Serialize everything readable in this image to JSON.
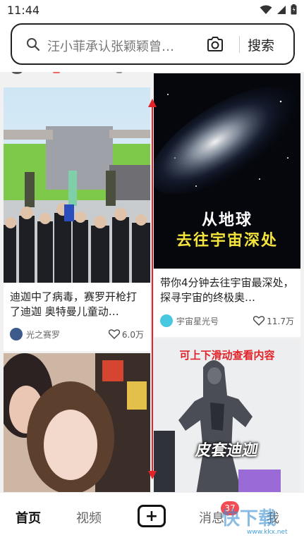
{
  "status_bar": {
    "time": "11:44"
  },
  "search": {
    "query": "汪小菲承认张颖颖曾…",
    "button_label": "搜索"
  },
  "feed": {
    "cards": [
      {
        "title": "迪迦中了病毒，赛罗开枪打了迪迦 奥特曼儿童动…",
        "author": "光之赛罗",
        "likes": "6.0万"
      },
      {
        "title": "带你4分钟去往宇宙最深处，探寻宇宙的终极奥…",
        "author": "宇宙星光号",
        "likes": "11.7万",
        "overlay_line1": "从地球",
        "overlay_line2": "去往宇宙深处"
      },
      {
        "title": ""
      },
      {
        "title": "",
        "overlay_top": "可上下滑动查看内容",
        "overlay_bottom": "皮套迪迦"
      }
    ]
  },
  "tabs": {
    "home": "首页",
    "video": "视频",
    "add": "+",
    "messages": "消息",
    "messages_badge": "37",
    "me": "我"
  },
  "watermark": {
    "text": "快下载",
    "site": "www.kkx.net"
  },
  "colors": {
    "accent_red": "#e3232a",
    "badge": "#f24d55",
    "text": "#222222"
  }
}
